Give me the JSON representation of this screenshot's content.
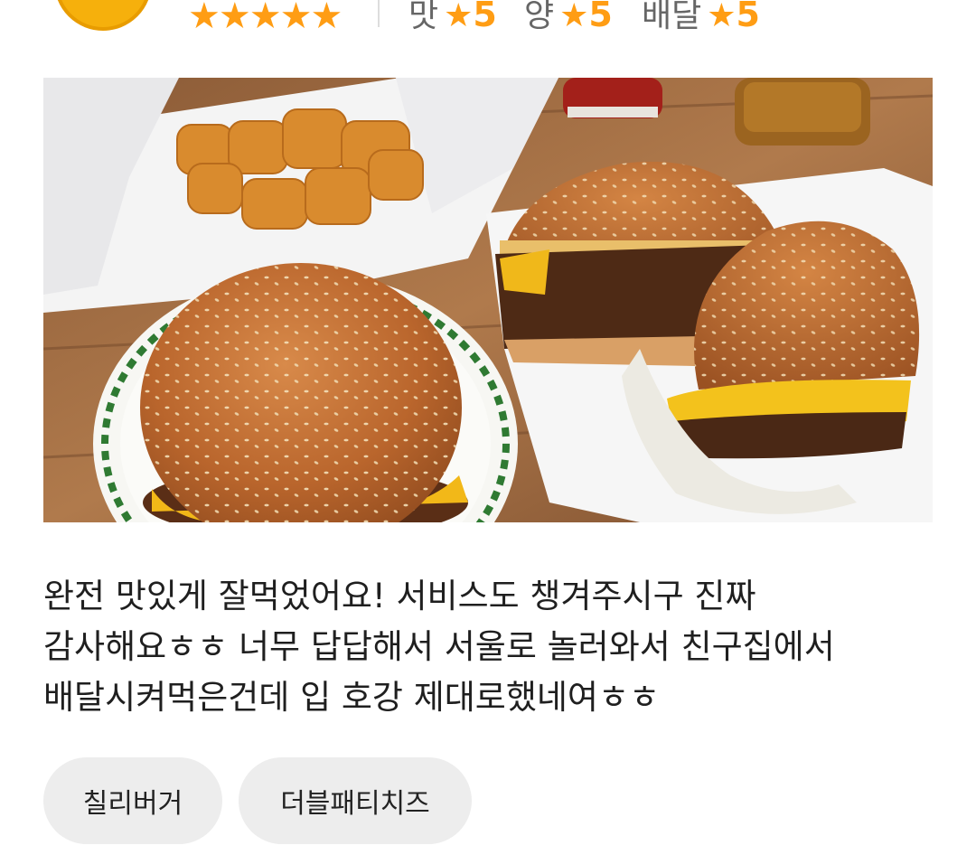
{
  "colors": {
    "star": "#ff9d14",
    "tag_bg": "#ededed",
    "text": "#1f1f1f"
  },
  "rating": {
    "overall_stars": "★★★★★",
    "overall_value": 5,
    "taste": {
      "label": "맛",
      "star": "★",
      "value": "5"
    },
    "quantity": {
      "label": "양",
      "star": "★",
      "value": "5"
    },
    "delivery": {
      "label": "배달",
      "star": "★",
      "value": "5"
    }
  },
  "review": {
    "text": "완전 맛있게 잘먹었어요! 서비스도 챙겨주시구 진짜\n감사해요ㅎㅎ 너무 답답해서 서울로 놀러와서 친구집에서\n배달시켜먹은건데 입 호강 제대로했네여ㅎㅎ"
  },
  "tags": [
    {
      "label": "칠리버거"
    },
    {
      "label": "더블패티치즈"
    }
  ]
}
